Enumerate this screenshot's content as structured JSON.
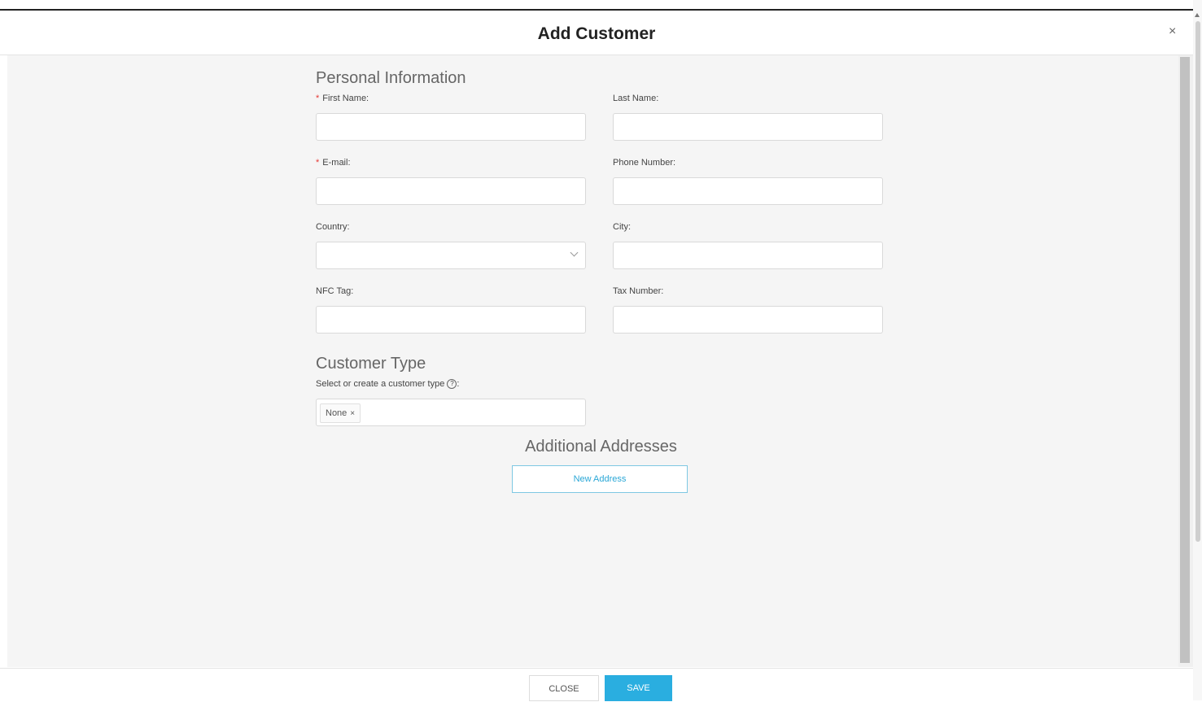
{
  "dialog": {
    "title": "Add Customer",
    "close_icon": "×"
  },
  "personal": {
    "section_title": "Personal Information",
    "required_mark": "*",
    "first_name_label": "First Name:",
    "last_name_label": "Last Name:",
    "email_label": "E-mail:",
    "phone_label": "Phone Number:",
    "country_label": "Country:",
    "city_label": "City:",
    "nfc_label": "NFC Tag:",
    "tax_label": "Tax Number:"
  },
  "customer_type": {
    "section_title": "Customer Type",
    "hint": "Select or create a customer type",
    "help_icon": "?",
    "help_suffix": ":",
    "tag_label": "None",
    "tag_remove": "×"
  },
  "addresses": {
    "section_title": "Additional Addresses",
    "new_address_label": "New Address"
  },
  "footer": {
    "close_label": "CLOSE",
    "save_label": "SAVE"
  },
  "colors": {
    "accent": "#2aaee0",
    "required": "#e53935",
    "body_bg": "#f5f5f5"
  }
}
